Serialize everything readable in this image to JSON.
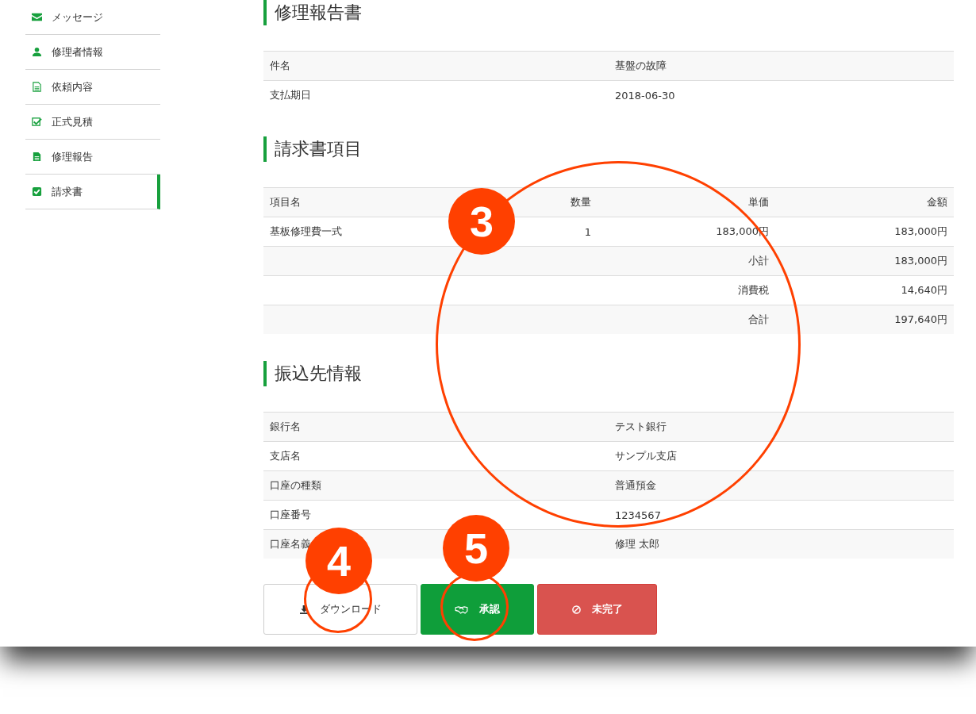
{
  "sidebar": {
    "items": [
      {
        "label": "メッセージ",
        "selected": false
      },
      {
        "label": "修理者情報",
        "selected": false
      },
      {
        "label": "依頼内容",
        "selected": false
      },
      {
        "label": "正式見積",
        "selected": false
      },
      {
        "label": "修理報告",
        "selected": false
      },
      {
        "label": "請求書",
        "selected": true
      }
    ]
  },
  "report": {
    "title": "修理報告書",
    "rows": [
      {
        "label": "件名",
        "value": "基盤の故障"
      },
      {
        "label": "支払期日",
        "value": "2018-06-30"
      }
    ]
  },
  "invoice": {
    "title": "請求書項目",
    "columns": [
      "項目名",
      "数量",
      "単価",
      "金額"
    ],
    "rows": [
      {
        "name": "基板修理費一式",
        "quantity": "1",
        "unit_price": "183,000円",
        "amount": "183,000円"
      }
    ],
    "totals": [
      {
        "label": "小計",
        "amount": "183,000円"
      },
      {
        "label": "消費税",
        "amount": "14,640円"
      },
      {
        "label": "合計",
        "amount": "197,640円"
      }
    ]
  },
  "bank": {
    "title": "振込先情報",
    "rows": [
      {
        "label": "銀行名",
        "value": "テスト銀行"
      },
      {
        "label": "支店名",
        "value": "サンプル支店"
      },
      {
        "label": "口座の種類",
        "value": "普通預金"
      },
      {
        "label": "口座番号",
        "value": "1234567"
      },
      {
        "label": "口座名義",
        "value": "修理 太郎"
      }
    ]
  },
  "buttons": [
    {
      "kind": "download",
      "label": "ダウンロード"
    },
    {
      "kind": "approve",
      "label": "承認"
    },
    {
      "kind": "incomplete",
      "label": "未完了"
    }
  ],
  "annotations": [
    {
      "label": "3"
    },
    {
      "label": "4"
    },
    {
      "label": "5"
    }
  ]
}
